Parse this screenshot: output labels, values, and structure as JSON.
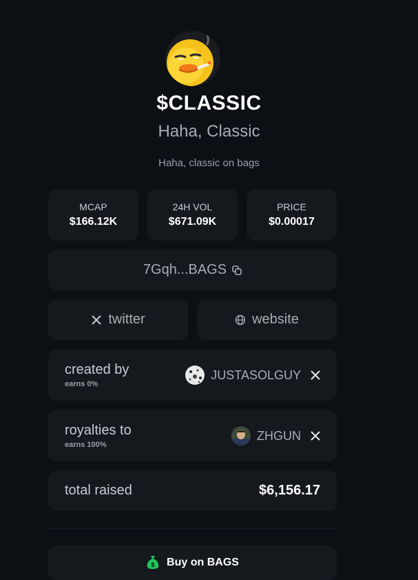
{
  "token": {
    "ticker": "$CLASSIC",
    "name": "Haha, Classic",
    "description": "Haha, classic on bags",
    "avatar_icon": "duck-smoking-icon"
  },
  "stats": [
    {
      "label": "MCAP",
      "value": "$166.12K"
    },
    {
      "label": "24H VOL",
      "value": "$671.09K"
    },
    {
      "label": "PRICE",
      "value": "$0.00017"
    }
  ],
  "contract": {
    "address": "7Gqh...BAGS",
    "icon": "copy-icon"
  },
  "links": {
    "twitter": {
      "label": "twitter",
      "icon": "x-icon"
    },
    "website": {
      "label": "website",
      "icon": "globe-icon"
    }
  },
  "creator": {
    "label": "created by",
    "earns": "earns 0%",
    "username": "JUSTASOLGUY"
  },
  "royalties": {
    "label": "royalties to",
    "earns": "earns 100%",
    "username": "ZHGUN"
  },
  "raised": {
    "label": "total raised",
    "value": "$6,156.17"
  },
  "buy": {
    "label": "Buy on BAGS",
    "icon": "money-bag-icon"
  },
  "colors": {
    "background": "#0c0f14",
    "card": "#15181d",
    "text_primary": "#ffffff",
    "text_muted": "#a8adb7",
    "buy_icon": "#22c55e"
  }
}
